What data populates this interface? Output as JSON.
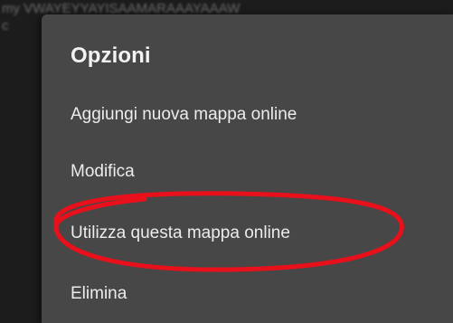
{
  "background": {
    "lines": [
      "my VWAYEYYAYISAAMARAAAYAAAW",
      "c"
    ]
  },
  "dialog": {
    "title": "Opzioni",
    "items": [
      {
        "label": "Aggiungi nuova mappa online"
      },
      {
        "label": "Modifica"
      },
      {
        "label": "Utilizza questa mappa online",
        "highlighted": true
      },
      {
        "label": "Elimina"
      }
    ]
  },
  "colors": {
    "dialog_bg": "#474747",
    "screen_bg": "#1c1c1c",
    "highlight": "#e8101a",
    "text": "#ececec"
  }
}
